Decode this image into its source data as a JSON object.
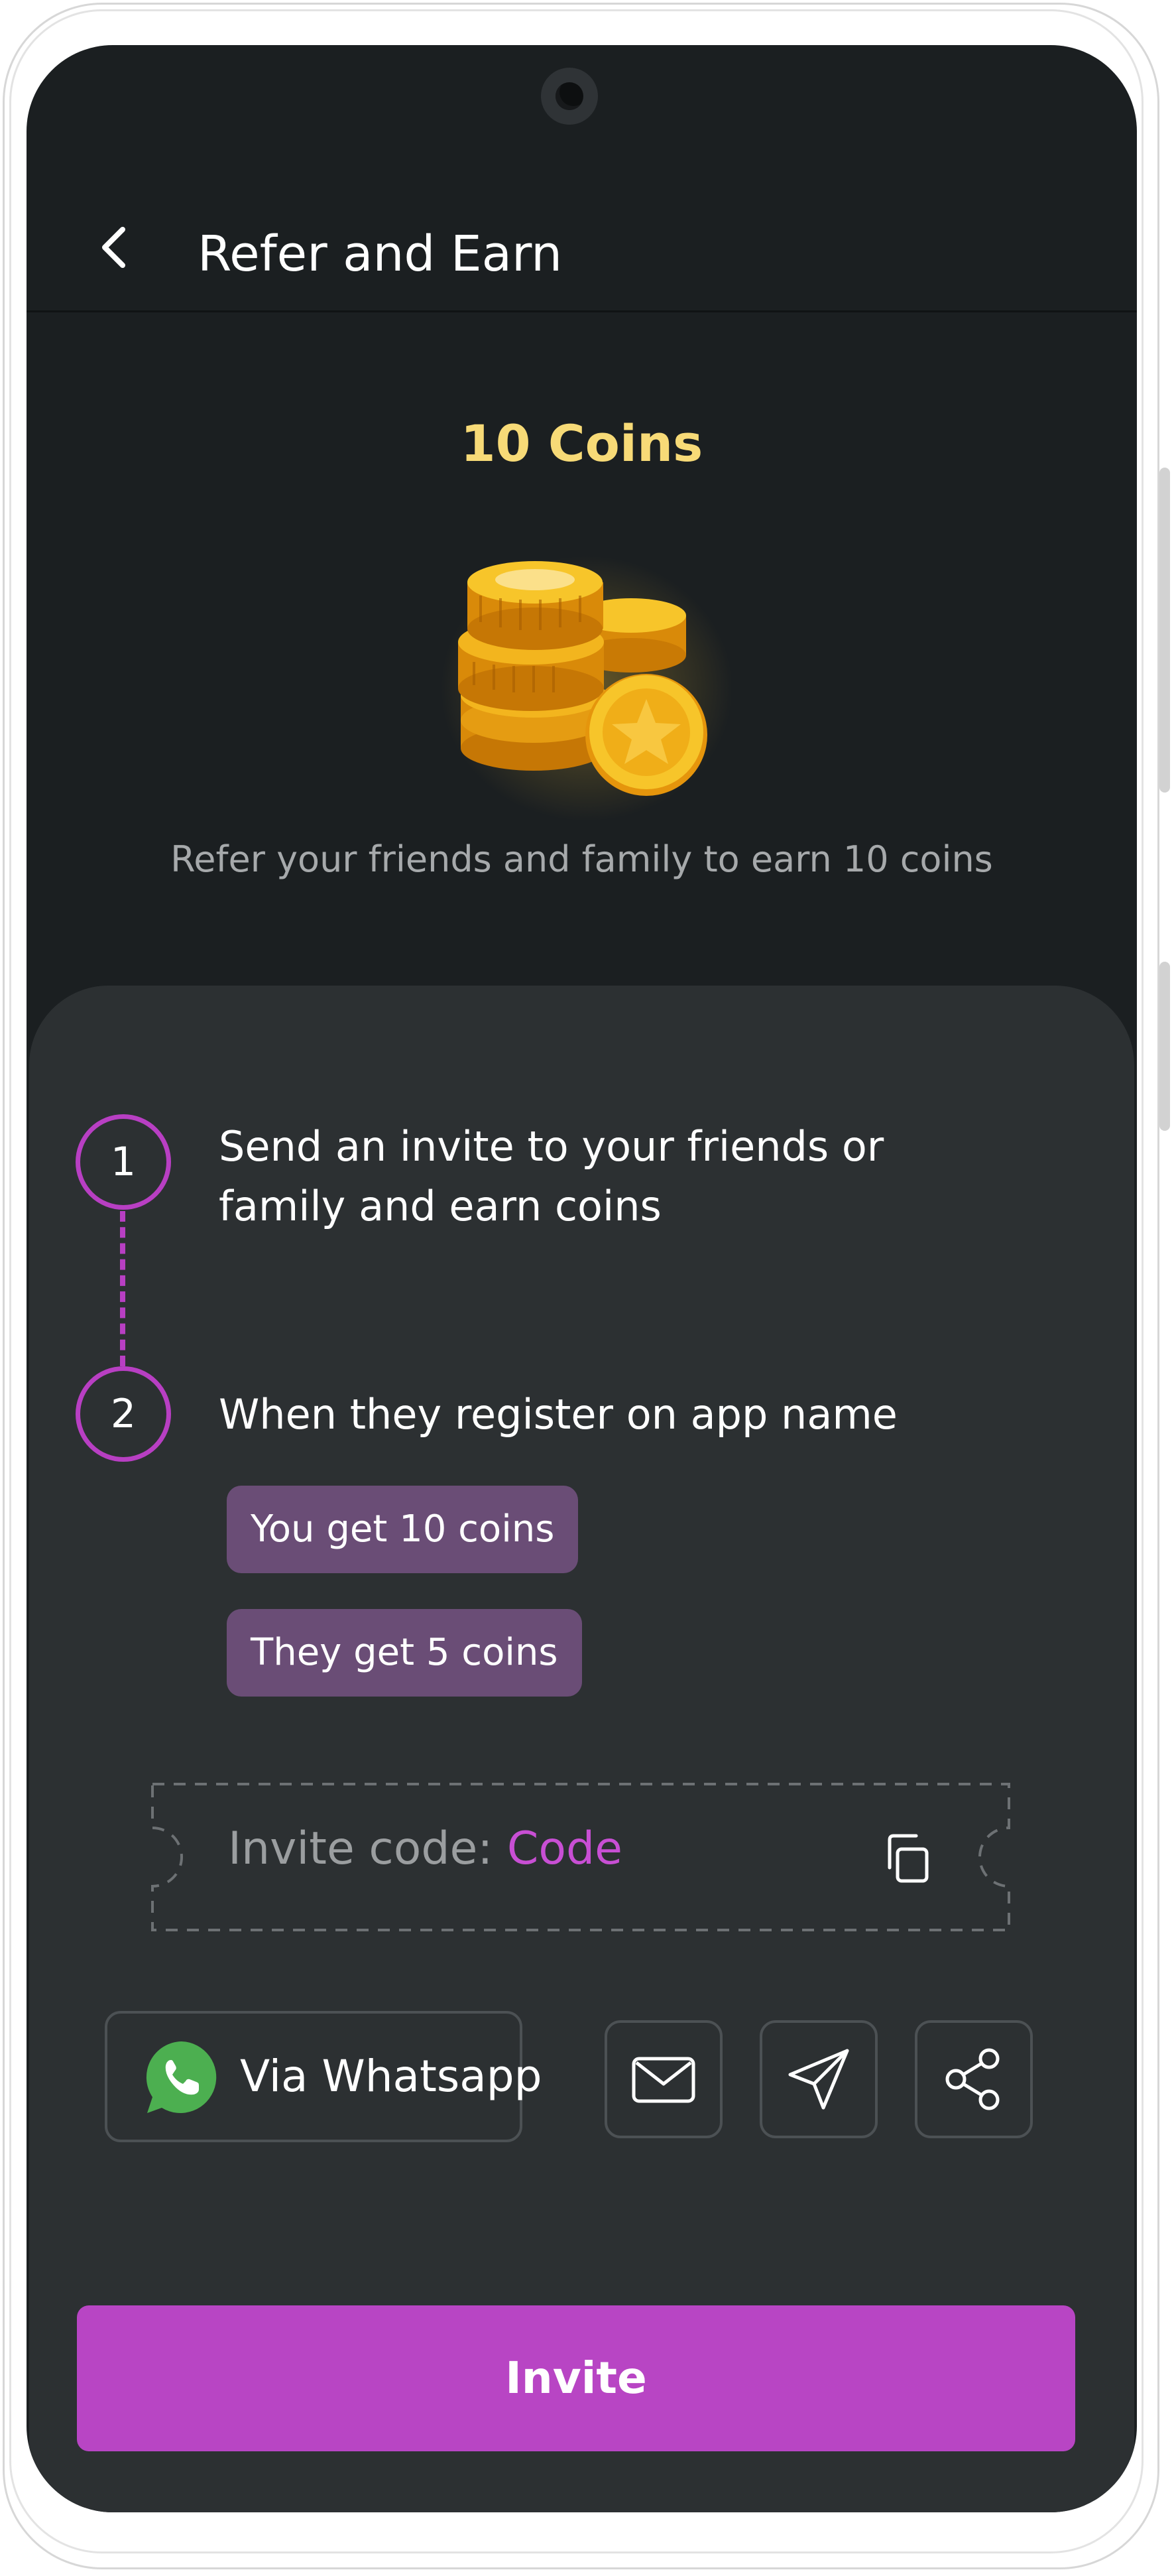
{
  "header": {
    "title": "Refer and Earn"
  },
  "reward": {
    "title": "10 Coins",
    "subtitle": "Refer your friends and family to earn 10 coins"
  },
  "steps": [
    {
      "number": "1",
      "text": "Send an invite to your friends or family and earn coins"
    },
    {
      "number": "2",
      "text": "When they register on app name"
    }
  ],
  "rewards_chips": [
    "You get 10 coins",
    "They get 5 coins"
  ],
  "invite_code": {
    "label": "Invite code: ",
    "value": "Code"
  },
  "share": {
    "whatsapp_label": "Via Whatsapp"
  },
  "invite_button": {
    "label": "Invite"
  },
  "colors": {
    "accent": "#b845c4",
    "coins_title": "#f7da77",
    "chip_bg": "#6a4d76",
    "background": "#1b1f21",
    "card": "#2c3032"
  },
  "icons": [
    "back-arrow-icon",
    "coins-icon",
    "copy-icon",
    "whatsapp-icon",
    "email-icon",
    "send-icon",
    "share-icon"
  ]
}
